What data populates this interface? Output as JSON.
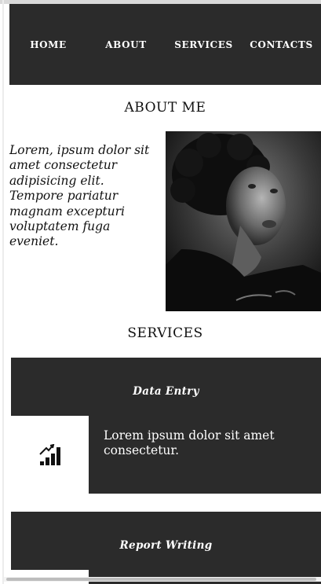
{
  "nav": {
    "items": [
      {
        "label": "HOME"
      },
      {
        "label": "ABOUT"
      },
      {
        "label": "SERVICES"
      },
      {
        "label": "CONTACTS"
      }
    ]
  },
  "about": {
    "heading": "ABOUT ME",
    "text": "Lorem, ipsum dolor sit amet consectetur adipisicing elit. Tempore pariatur magnam excepturi voluptatem fuga eveniet.",
    "photo_icon": "portrait-photo"
  },
  "services": {
    "heading": "SERVICES",
    "cards": [
      {
        "title": "Data Entry",
        "icon": "signal-bars-icon",
        "description": "Lorem ipsum dolor sit amet consectetur."
      },
      {
        "title": "Report Writing",
        "icon": "document-icon"
      }
    ]
  },
  "colors": {
    "nav_background": "#2b2b2b",
    "card_background": "#2b2b2b",
    "text": "#111111",
    "nav_text": "#ffffff"
  }
}
